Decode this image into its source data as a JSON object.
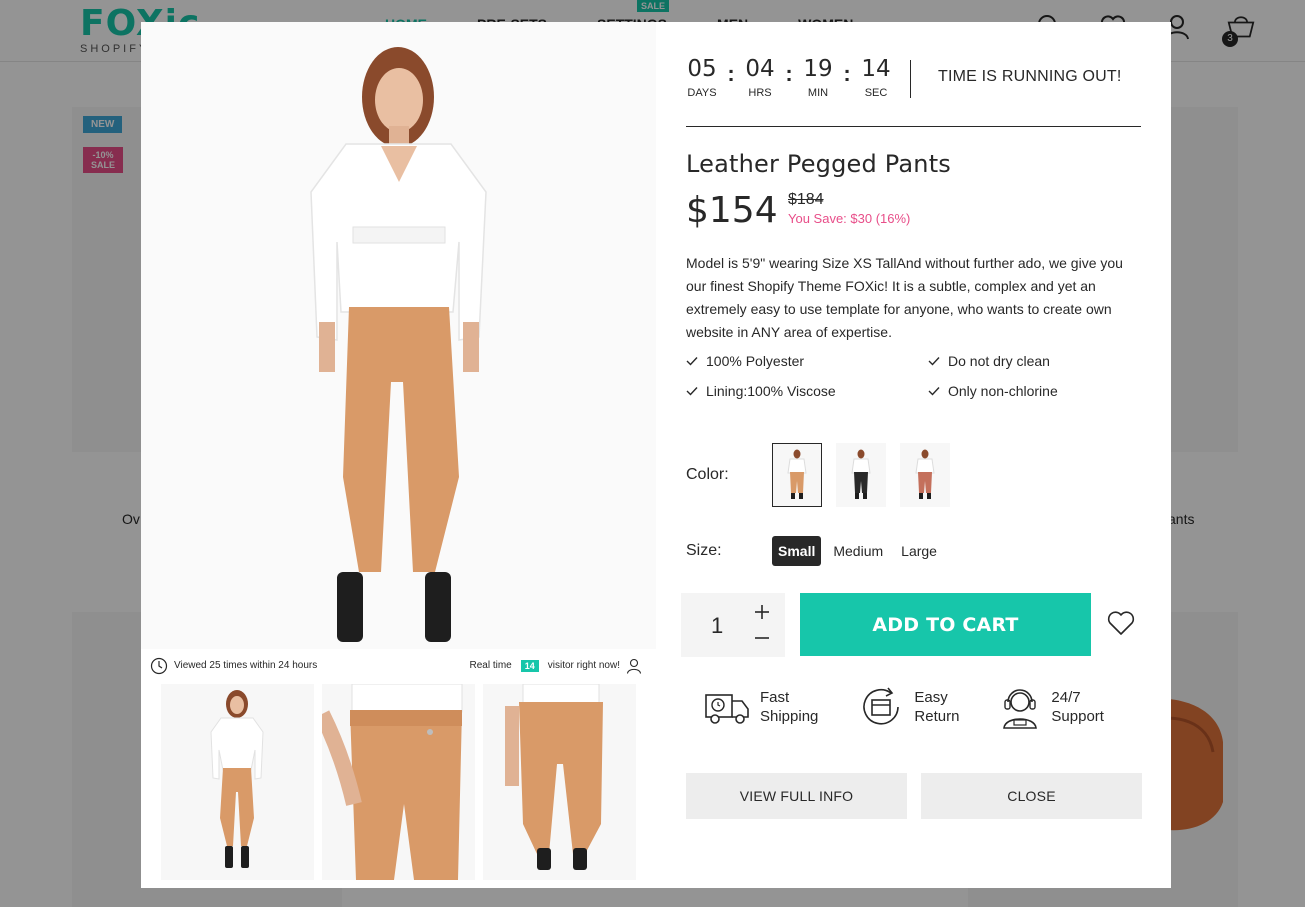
{
  "background": {
    "logo": {
      "mark": "FOXic",
      "sub": "SHOPIFY"
    },
    "nav": [
      "HOME",
      "PRE-SETS",
      "SETTINGS",
      "MEN",
      "WOMEN"
    ],
    "nav_sale_badge": "SALE",
    "cart_count": "3",
    "labels": {
      "new": "NEW",
      "sale_pct": "-10%",
      "sale": "SALE"
    },
    "card_text_left": "Ov",
    "card_text_right": "ants"
  },
  "modal": {
    "countdown": {
      "units": [
        {
          "value": "05",
          "label": "DAYS"
        },
        {
          "value": "04",
          "label": "HRS"
        },
        {
          "value": "19",
          "label": "MIN"
        },
        {
          "value": "14",
          "label": "SEC"
        }
      ],
      "separator": ":",
      "note": "TIME IS RUNNING OUT!"
    },
    "title": "Leather Pegged Pants",
    "price": "$154",
    "old_price": "$184",
    "you_save": "You Save: $30 (16%)",
    "description": "Model is 5'9\" wearing Size XS TallAnd without further ado, we give you our finest Shopify Theme FOXic! It is a subtle, complex and yet an extremely easy to use template for anyone, who wants to create own website in ANY area of expertise.",
    "features": [
      "100% Polyester",
      "Do not dry clean",
      "Lining:100% Viscose",
      "Only non-chlorine"
    ],
    "color_label": "Color:",
    "colors": [
      {
        "name": "Tan",
        "pants": "#d99a68",
        "selected": true
      },
      {
        "name": "Black",
        "pants": "#2a2a2a",
        "selected": false
      },
      {
        "name": "Rust",
        "pants": "#c4705c",
        "selected": false
      }
    ],
    "size_label": "Size:",
    "sizes": [
      {
        "label": "Small",
        "selected": true
      },
      {
        "label": "Medium",
        "selected": false
      },
      {
        "label": "Large",
        "selected": false
      }
    ],
    "quantity": "1",
    "add_to_cart": "ADD TO CART",
    "perks": [
      {
        "icon": "truck-icon",
        "line1": "Fast",
        "line2": "Shipping"
      },
      {
        "icon": "return-box-icon",
        "line1": "Easy",
        "line2": "Return"
      },
      {
        "icon": "support-agent-icon",
        "line1": "24/7",
        "line2": "Support"
      }
    ],
    "view_full_info": "VIEW FULL INFO",
    "close": "CLOSE",
    "views": {
      "viewed_text": "Viewed 25 times within 24 hours",
      "realtime_prefix": "Real time",
      "realtime_count": "14",
      "realtime_suffix": "visitor right now!"
    },
    "thumbnails": [
      "Full look",
      "Waist detail",
      "Back view"
    ]
  },
  "colors": {
    "accent": "#17c6aa",
    "sale_pink": "#e84e89",
    "dark": "#282828",
    "pants_tan": "#d99a68"
  }
}
